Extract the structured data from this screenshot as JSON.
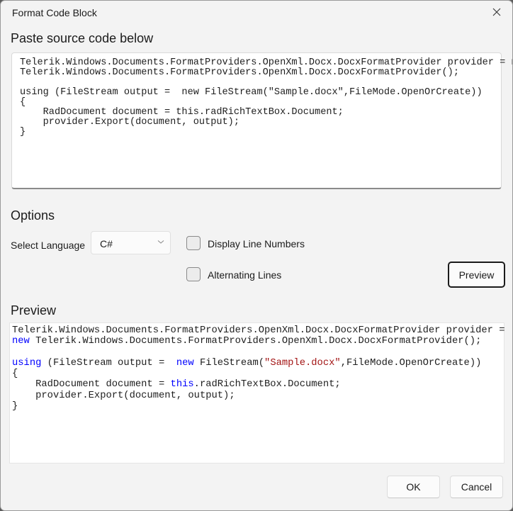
{
  "dialog": {
    "title": "Format Code Block"
  },
  "source": {
    "heading": "Paste source code below",
    "code": "Telerik.Windows.Documents.FormatProviders.OpenXml.Docx.DocxFormatProvider provider = new\nTelerik.Windows.Documents.FormatProviders.OpenXml.Docx.DocxFormatProvider();\n\nusing (FileStream output =  new FileStream(\"Sample.docx\",FileMode.OpenOrCreate))\n{\n    RadDocument document = this.radRichTextBox.Document;\n    provider.Export(document, output);\n}"
  },
  "options": {
    "heading": "Options",
    "language_label": "Select Language",
    "language_value": "C#",
    "line_numbers_label": "Display Line Numbers",
    "line_numbers_checked": false,
    "alternating_label": "Alternating Lines",
    "alternating_checked": false,
    "preview_button": "Preview"
  },
  "preview": {
    "heading": "Preview",
    "lines": [
      [
        {
          "t": "Telerik.Windows.Documents.FormatProviders.OpenXml.Docx.DocxFormatProvider provider =",
          "c": "plain"
        }
      ],
      [
        {
          "t": "new",
          "c": "kw"
        },
        {
          "t": " Telerik.Windows.Documents.FormatProviders.OpenXml.Docx.DocxFormatProvider();",
          "c": "plain"
        }
      ],
      [
        {
          "t": "",
          "c": "plain"
        }
      ],
      [
        {
          "t": "using",
          "c": "kw"
        },
        {
          "t": " (FileStream output =  ",
          "c": "plain"
        },
        {
          "t": "new",
          "c": "kw"
        },
        {
          "t": " FileStream(",
          "c": "plain"
        },
        {
          "t": "\"Sample.docx\"",
          "c": "str"
        },
        {
          "t": ",FileMode.OpenOrCreate))",
          "c": "plain"
        }
      ],
      [
        {
          "t": "{",
          "c": "plain"
        }
      ],
      [
        {
          "t": "    RadDocument document = ",
          "c": "plain"
        },
        {
          "t": "this",
          "c": "kw"
        },
        {
          "t": ".radRichTextBox.Document;",
          "c": "plain"
        }
      ],
      [
        {
          "t": "    provider.Export(document, output);",
          "c": "plain"
        }
      ],
      [
        {
          "t": "}",
          "c": "plain"
        }
      ]
    ]
  },
  "footer": {
    "ok": "OK",
    "cancel": "Cancel"
  }
}
